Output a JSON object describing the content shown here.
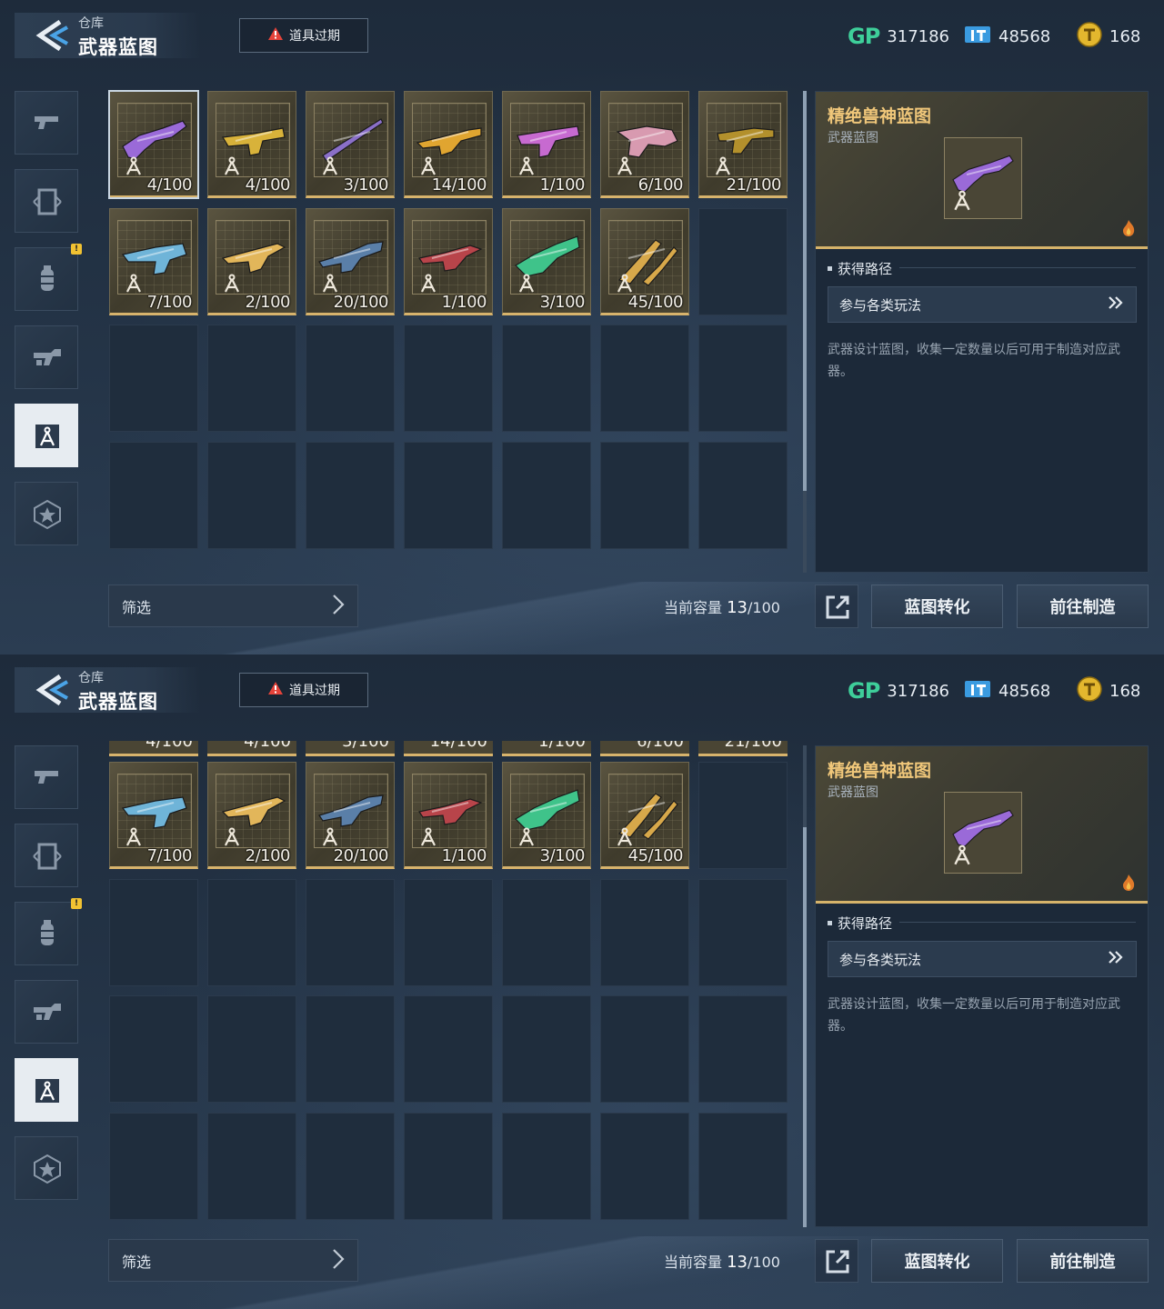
{
  "header": {
    "breadcrumb": "仓库",
    "title": "武器蓝图",
    "expire_button": "道具过期",
    "currencies": [
      {
        "icon": "gp-icon",
        "label": "GP",
        "value": "317186"
      },
      {
        "icon": "ticket-icon",
        "value": "48568"
      },
      {
        "icon": "coin-icon",
        "value": "168"
      }
    ]
  },
  "sidebar": {
    "items": [
      {
        "name": "pistol",
        "active": false,
        "badge": false
      },
      {
        "name": "frame",
        "active": false,
        "badge": false
      },
      {
        "name": "grenade",
        "active": false,
        "badge": true
      },
      {
        "name": "gun-mod",
        "active": false,
        "badge": false
      },
      {
        "name": "blueprint",
        "active": true,
        "badge": false
      },
      {
        "name": "star-badge",
        "active": false,
        "badge": false
      }
    ],
    "badge_text": "!"
  },
  "grid": {
    "items": [
      {
        "count": "4/100",
        "color": "#9a6ad8"
      },
      {
        "count": "4/100",
        "color": "#d8b23a"
      },
      {
        "count": "3/100",
        "color": "#8a6fc8"
      },
      {
        "count": "14/100",
        "color": "#e0a530"
      },
      {
        "count": "1/100",
        "color": "#c76ad0"
      },
      {
        "count": "6/100",
        "color": "#d89ab0"
      },
      {
        "count": "21/100",
        "color": "#b3902c"
      },
      {
        "count": "7/100",
        "color": "#6fb4d8"
      },
      {
        "count": "2/100",
        "color": "#e2b65a"
      },
      {
        "count": "20/100",
        "color": "#5a7fa8"
      },
      {
        "count": "1/100",
        "color": "#b8444a"
      },
      {
        "count": "3/100",
        "color": "#3fc38a"
      },
      {
        "count": "45/100",
        "color": "#d7a84a"
      }
    ],
    "total_slots": 28
  },
  "detail": {
    "name": "精绝兽神蓝图",
    "type": "武器蓝图",
    "section_title": "获得路径",
    "path_button": "参与各类玩法",
    "description": "武器设计蓝图，收集一定数量以后可用于制造对应武器。"
  },
  "footer": {
    "filter_label": "筛选",
    "capacity_label": "当前容量",
    "capacity_current": "13",
    "capacity_total": "/100",
    "convert_button": "蓝图转化",
    "craft_button": "前往制造"
  },
  "colors": {
    "accent_gold": "#d7b36c",
    "title_gold": "#f0c77a",
    "gp_green": "#3ecf9a",
    "ticket_blue": "#3a9be0",
    "coin_gold": "#e3b72e"
  }
}
